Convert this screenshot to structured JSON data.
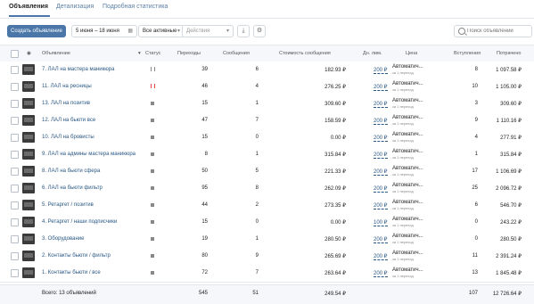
{
  "tabs": [
    {
      "label": "Объявления"
    },
    {
      "label": "Детализация"
    },
    {
      "label": "Подробная статистика"
    }
  ],
  "toolbar": {
    "create_label": "Создать объявление",
    "date_range": "5 июня – 18 июня",
    "filter": "Все активные",
    "actions": "Действия",
    "search_placeholder": "Поиск объявлений"
  },
  "columns": {
    "name": "Объявление",
    "status": "Статус",
    "clicks": "Переходы",
    "messages": "Сообщения",
    "cost_per_msg": "Стоимость сообщения",
    "daily_limit": "Дн. лим.",
    "price": "Цена",
    "joins": "Вступления",
    "spent": "Потрачено"
  },
  "rows": [
    {
      "name": "7. ЛАЛ на мастера маникюра",
      "status": "paused",
      "clicks": "39",
      "messages": "6",
      "cost": "182.93 ₽",
      "limit": "200 ₽",
      "price": "Автоматич...",
      "price_sub": "за 1 переход",
      "joins": "8",
      "spent": "1 097.58 ₽"
    },
    {
      "name": "11. ЛАЛ на ресницы",
      "status": "paused-red",
      "clicks": "46",
      "messages": "4",
      "cost": "276.25 ₽",
      "limit": "200 ₽",
      "price": "Автоматич...",
      "price_sub": "за 1 переход",
      "joins": "10",
      "spent": "1 105.00 ₽"
    },
    {
      "name": "13. ЛАЛ на позитив",
      "status": "stopped",
      "clicks": "15",
      "messages": "1",
      "cost": "309.60 ₽",
      "limit": "200 ₽",
      "price": "Автоматич...",
      "price_sub": "за 1 переход",
      "joins": "3",
      "spent": "309.60 ₽"
    },
    {
      "name": "12. ЛАЛ на бьюти все",
      "status": "stopped",
      "clicks": "47",
      "messages": "7",
      "cost": "158.59 ₽",
      "limit": "200 ₽",
      "price": "Автоматич...",
      "price_sub": "за 1 переход",
      "joins": "9",
      "spent": "1 110.16 ₽"
    },
    {
      "name": "10. ЛАЛ на бровисты",
      "status": "stopped",
      "clicks": "15",
      "messages": "0",
      "cost": "0.00 ₽",
      "limit": "200 ₽",
      "price": "Автоматич...",
      "price_sub": "за 1 переход",
      "joins": "4",
      "spent": "277.91 ₽"
    },
    {
      "name": "9. ЛАЛ на админы мастера маникюра",
      "status": "stopped",
      "clicks": "8",
      "messages": "1",
      "cost": "315.84 ₽",
      "limit": "200 ₽",
      "price": "Автоматич...",
      "price_sub": "за 1 переход",
      "joins": "1",
      "spent": "315.84 ₽"
    },
    {
      "name": "8. ЛАЛ на бьюти сфера",
      "status": "stopped",
      "clicks": "50",
      "messages": "5",
      "cost": "221.33 ₽",
      "limit": "200 ₽",
      "price": "Автоматич...",
      "price_sub": "за 1 переход",
      "joins": "17",
      "spent": "1 106.69 ₽"
    },
    {
      "name": "6. ЛАЛ на бьюти фильтр",
      "status": "stopped",
      "clicks": "95",
      "messages": "8",
      "cost": "262.09 ₽",
      "limit": "200 ₽",
      "price": "Автоматич...",
      "price_sub": "за 1 переход",
      "joins": "25",
      "spent": "2 096.72 ₽"
    },
    {
      "name": "5. Ретаргет / позитив",
      "status": "stopped",
      "clicks": "44",
      "messages": "2",
      "cost": "273.35 ₽",
      "limit": "200 ₽",
      "price": "Автоматич...",
      "price_sub": "за 1 переход",
      "joins": "6",
      "spent": "546.70 ₽"
    },
    {
      "name": "4. Ретаргет / наши подписчики",
      "status": "stopped",
      "clicks": "15",
      "messages": "0",
      "cost": "0.00 ₽",
      "limit": "100 ₽",
      "price": "Автоматич...",
      "price_sub": "за 1 переход",
      "joins": "0",
      "spent": "243.22 ₽"
    },
    {
      "name": "3. Оборудование",
      "status": "stopped",
      "clicks": "19",
      "messages": "1",
      "cost": "280.50 ₽",
      "limit": "200 ₽",
      "price": "Автоматич...",
      "price_sub": "за 1 переход",
      "joins": "0",
      "spent": "280.50 ₽"
    },
    {
      "name": "2. Контакты бьюти / фильтр",
      "status": "stopped",
      "clicks": "80",
      "messages": "9",
      "cost": "265.69 ₽",
      "limit": "200 ₽",
      "price": "Автоматич...",
      "price_sub": "за 1 переход",
      "joins": "11",
      "spent": "2 391.24 ₽"
    },
    {
      "name": "1. Контакты бьюти / все",
      "status": "stopped",
      "clicks": "72",
      "messages": "7",
      "cost": "263.64 ₽",
      "limit": "200 ₽",
      "price": "Автоматич...",
      "price_sub": "за 1 переход",
      "joins": "13",
      "spent": "1 845.48 ₽"
    }
  ],
  "totals": {
    "label": "Всего: 13 объявлений",
    "clicks": "545",
    "messages": "51",
    "cost": "249.54 ₽",
    "joins": "107",
    "spent": "12 726.64 ₽"
  },
  "colors": {
    "accent": "#4a76a8",
    "link": "#2a5885",
    "paused_red": "#e64646"
  }
}
